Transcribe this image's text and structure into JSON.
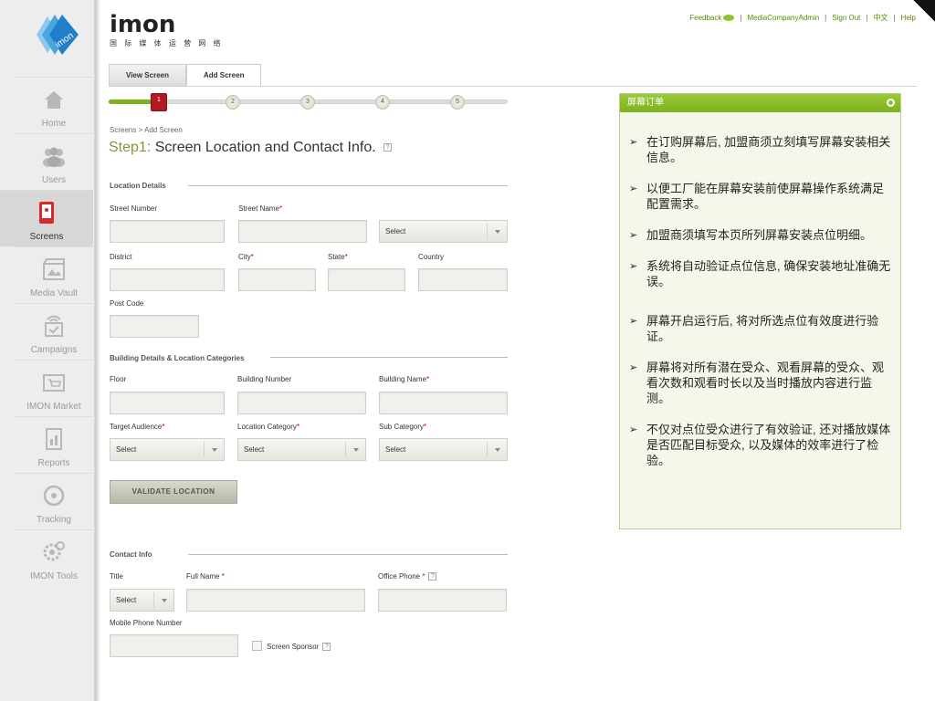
{
  "brand": {
    "name": "imon",
    "subtitle": "国 际 媒 体 运 营 网 络",
    "logo_text": "imon"
  },
  "top_links": {
    "feedback": "Feedback",
    "account": "MediaCompanyAdmin",
    "sign_out": "Sign Out",
    "language": "中文",
    "help": "Help"
  },
  "sidebar": {
    "items": [
      {
        "label": "Home",
        "icon": "home-icon"
      },
      {
        "label": "Users",
        "icon": "users-icon"
      },
      {
        "label": "Screens",
        "icon": "screen-icon"
      },
      {
        "label": "Media Vault",
        "icon": "media-vault-icon"
      },
      {
        "label": "Campaigns",
        "icon": "campaigns-icon"
      },
      {
        "label": "IMON Market",
        "icon": "market-icon"
      },
      {
        "label": "Reports",
        "icon": "reports-icon"
      },
      {
        "label": "Tracking",
        "icon": "tracking-icon"
      },
      {
        "label": "IMON Tools",
        "icon": "tools-icon"
      }
    ],
    "active": "Screens"
  },
  "tabs": [
    {
      "label": "View Screen"
    },
    {
      "label": "Add Screen"
    }
  ],
  "stepper": {
    "steps": [
      "1",
      "2",
      "3",
      "4",
      "5"
    ],
    "current": 1,
    "progress": 0.12
  },
  "breadcrumb": "Screens > Add Screen",
  "page_title": {
    "step": "Step1:",
    "text": "Screen Location and Contact Info."
  },
  "location": {
    "heading": "Location Details",
    "street_number": "Street Number",
    "street_name": "Street Name",
    "street_type_select": "Select",
    "district": "District",
    "city": "City",
    "state": "State",
    "country": "Country",
    "post_code": "Post Code"
  },
  "building": {
    "heading": "Building Details & Location Categories",
    "floor": "Floor",
    "building_number": "Building Number",
    "building_name": "Building Name",
    "target_audience": "Target Audience",
    "location_category": "Location Category",
    "sub_category": "Sub Category",
    "select": "Select",
    "validate_button": "VALIDATE LOCATION"
  },
  "contact": {
    "heading": "Contact Info",
    "title": "Title",
    "title_select": "Select",
    "full_name": "Full Name",
    "office_phone": "Office Phone",
    "mobile_phone": "Mobile Phone Number",
    "screen_sponsor": "Screen Sponsor"
  },
  "required_mark": "*",
  "help_mark": "?",
  "info_panel": {
    "title": "屏幕订单",
    "items": [
      "在订购屏幕后, 加盟商须立刻填写屏幕安装相关信息。",
      "以便工厂能在屏幕安装前使屏幕操作系统满足配置需求。",
      "加盟商须填写本页所列屏幕安装点位明细。",
      "系统将自动验证点位信息, 确保安装地址准确无误。",
      "屏幕开启运行后, 将对所选点位有效度进行验证。",
      "屏幕将对所有潜在受众、观看屏幕的受众、观看次数和观看时长以及当时播放内容进行监测。",
      "不仅对点位受众进行了有效验证, 还对播放媒体是否匹配目标受众, 以及媒体的效率进行了检验。"
    ]
  },
  "colors": {
    "accent": "#7db21c",
    "active_step": "#b31920",
    "title_step": "#7c9a3a"
  }
}
